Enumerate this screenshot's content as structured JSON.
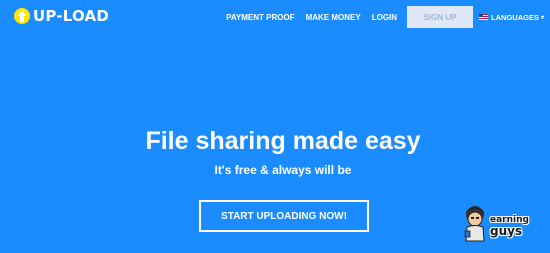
{
  "brand": {
    "logo_text": "UP-LOAD",
    "logo_color": "#ffe600"
  },
  "nav": {
    "items": [
      "PAYMENT PROOF",
      "MAKE MONEY",
      "LOGIN"
    ],
    "signup_label": "SIGN UP",
    "languages_label": "LANGUAGES",
    "caret_icon": "caret-down-icon",
    "flag_icon": "us-flag-icon"
  },
  "hero": {
    "title": "File sharing made easy",
    "subtitle": "It's free & always will be",
    "cta_label": "START UPLOADING NOW!"
  },
  "watermark": {
    "top_word": "earning",
    "bottom_word": "guys"
  },
  "colors": {
    "background": "#1a8cff",
    "signup_bg": "#dfe8f6",
    "signup_text": "#8aa2c4",
    "text": "#ffffff"
  }
}
